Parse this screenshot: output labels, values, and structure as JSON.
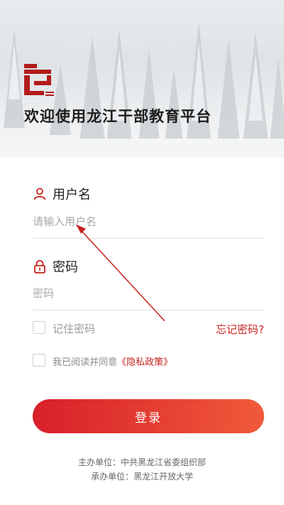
{
  "header": {
    "welcome": "欢迎使用龙江干部教育平台"
  },
  "form": {
    "username_label": "用户名",
    "username_placeholder": "请输入用户名",
    "password_label": "密码",
    "password_placeholder": "密码",
    "remember_label": "记住密码",
    "forgot_label": "忘记密码?",
    "agree_prefix": "我已阅读并同意",
    "policy_link": "《隐私政策》",
    "login_button": "登录"
  },
  "footer": {
    "host": "主办单位：中共黑龙江省委组织部",
    "organizer": "承办单位：黑龙江开放大学"
  },
  "icons": {
    "user": "user-icon",
    "lock": "lock-icon",
    "logo": "logo-icon"
  },
  "colors": {
    "accent": "#c4231d",
    "button_start": "#d8202a",
    "button_end": "#f05a3a",
    "annotation_arrow": "#c4231d"
  }
}
